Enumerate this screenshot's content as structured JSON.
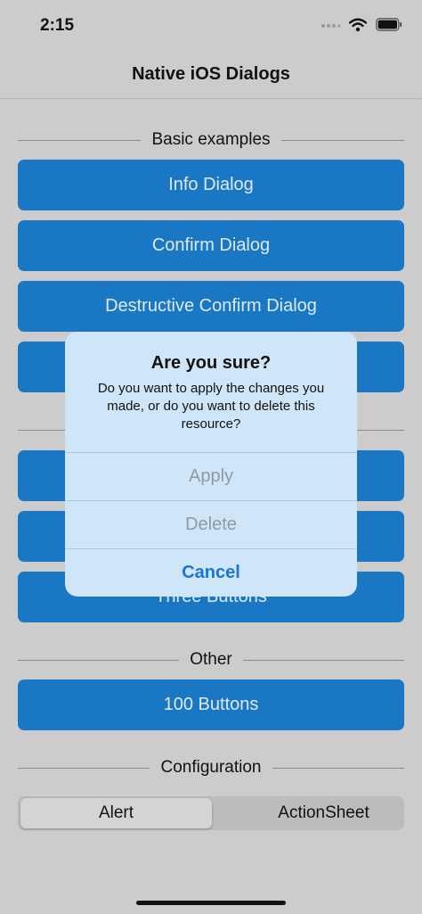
{
  "status": {
    "time": "2:15"
  },
  "nav": {
    "title": "Native iOS Dialogs"
  },
  "sections": {
    "basic": "Basic examples",
    "other": "Other",
    "configuration": "Configuration"
  },
  "buttons": {
    "info": "Info Dialog",
    "confirm": "Confirm Dialog",
    "destructive": "Destructive Confirm Dialog",
    "three": "Three Buttons",
    "hundred": "100 Buttons"
  },
  "segmented": {
    "options": [
      "Alert",
      "ActionSheet"
    ],
    "selected": "Alert"
  },
  "dialog": {
    "title": "Are you sure?",
    "message": "Do you want to apply the changes you made, or do you want to delete this resource?",
    "actions": [
      "Apply",
      "Delete",
      "Cancel"
    ]
  },
  "colors": {
    "button": "#1a77c3",
    "accent": "#1a76d2",
    "background": "#cccccc"
  }
}
